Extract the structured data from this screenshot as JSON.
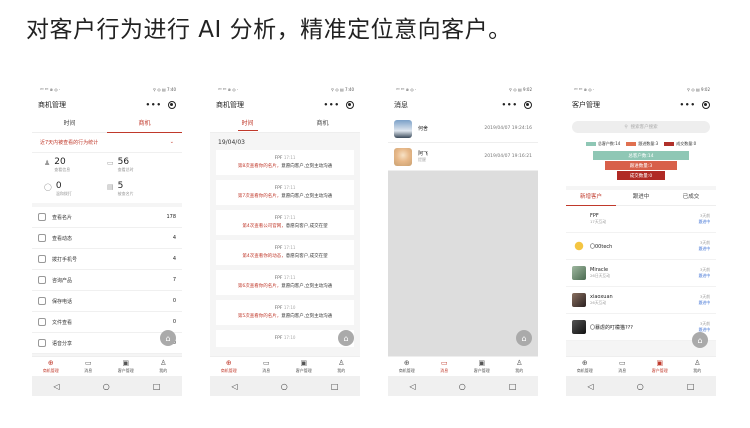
{
  "headline": "对客户行为进行 AI 分析，精准定位意向客户。",
  "status": {
    "left": "⁴ᴳ ⁴ᴳ ⊗ ◎ ·",
    "right1": "⚲ ◎ ▤ 7:40",
    "right3": "⚲ ◎ ▤ 9:02"
  },
  "nav_glyphs": [
    "◁",
    "○",
    "□"
  ],
  "fab_glyph": "⌂",
  "bottom_tabs": [
    {
      "glyph": "⊕",
      "label": "商机管理"
    },
    {
      "glyph": "▭",
      "label": "消息"
    },
    {
      "glyph": "▣",
      "label": "客户管理"
    },
    {
      "glyph": "♙",
      "label": "我的"
    }
  ],
  "screen1": {
    "title": "商机管理",
    "capsule_dots": "•••",
    "tabs": [
      "时间",
      "商机"
    ],
    "link_text": "近7天内被查看的行为统计",
    "link_arrow": "⌄",
    "stats": [
      {
        "icon": "♟",
        "num": "20",
        "label": "查看信息"
      },
      {
        "icon": "▭",
        "num": "56",
        "label": "查看总时"
      },
      {
        "icon": "◯",
        "num": "0",
        "label": "温和拨打"
      },
      {
        "icon": "▤",
        "num": "5",
        "label": "被查名片"
      }
    ],
    "rows": [
      {
        "label": "查看名片",
        "value": "178"
      },
      {
        "label": "查看动态",
        "value": "4"
      },
      {
        "label": "拨打手机号",
        "value": "4"
      },
      {
        "label": "咨询产品",
        "value": "7"
      },
      {
        "label": "保存电话",
        "value": "0"
      },
      {
        "label": "文件查看",
        "value": "0"
      },
      {
        "label": "语音分享",
        "value": "0"
      }
    ]
  },
  "screen2": {
    "title": "商机管理",
    "tabs": [
      "时间",
      "商机"
    ],
    "date": "19/04/03",
    "cards": [
      {
        "user": "FPF",
        "time": "17:11",
        "msg_a": "第8次查看你的名片，",
        "msg_b": "意愿向客户,立刻主动沟通"
      },
      {
        "user": "FPF",
        "time": "17:11",
        "msg_a": "第7次查看你的名片，",
        "msg_b": "意愿向客户,立刻主动沟通"
      },
      {
        "user": "FPF",
        "time": "17:11",
        "msg_a": "第4次查看公司官网，",
        "msg_b": "意愿向客户,成交在望"
      },
      {
        "user": "FPF",
        "time": "17:11",
        "msg_a": "第4次查看你的动态，",
        "msg_b": "意愿向客户,成交在望"
      },
      {
        "user": "FPF",
        "time": "17:11",
        "msg_a": "第6次查看你的名片，",
        "msg_b": "意愿向客户,立刻主动沟通"
      },
      {
        "user": "FPF",
        "time": "17:10",
        "msg_a": "第5次查看你的名片，",
        "msg_b": "意愿向客户,立刻主动沟通"
      },
      {
        "user": "FPF",
        "time": "17:10",
        "msg_a": "",
        "msg_b": ""
      }
    ]
  },
  "screen3": {
    "title": "消息",
    "messages": [
      {
        "name": "何舍",
        "sub": "",
        "time": "2019/04/07 19:24:16"
      },
      {
        "name": "阿飞",
        "sub": "提醒",
        "time": "2019/04/07 19:16:21"
      }
    ]
  },
  "screen4": {
    "title": "客户管理",
    "search_placeholder": "搜索客户搜索",
    "legend": [
      {
        "label": "总客户数:14",
        "color": "#8fc7b5"
      },
      {
        "label": "跟进数量:3",
        "color": "#e07050"
      },
      {
        "label": "成交数量:0",
        "color": "#b0302a"
      }
    ],
    "funnel": [
      {
        "label": "总客户数:14",
        "color": "#8fc7b5"
      },
      {
        "label": "跟进数量:3",
        "color": "#d8604a"
      },
      {
        "label": "成交数量:0",
        "color": "#b02a25"
      }
    ],
    "tabs": [
      "新增客户",
      "跟进中",
      "已成交"
    ],
    "customers": [
      {
        "name": "FPF",
        "sub": "17天互动",
        "r1": "3天前",
        "r2": "跟进中"
      },
      {
        "name": "〇00tech",
        "sub": "",
        "r1": "3天前",
        "r2": "跟进中"
      },
      {
        "name": "Miracle",
        "sub": "26日天互动",
        "r1": "3天前",
        "r2": "跟进中"
      },
      {
        "name": "xiaoxuan",
        "sub": "26天互动",
        "r1": "3天前",
        "r2": "跟进中"
      },
      {
        "name": "〇暴虐的叮檬猫???",
        "sub": "",
        "r1": "3天前",
        "r2": "跟进中"
      }
    ]
  }
}
